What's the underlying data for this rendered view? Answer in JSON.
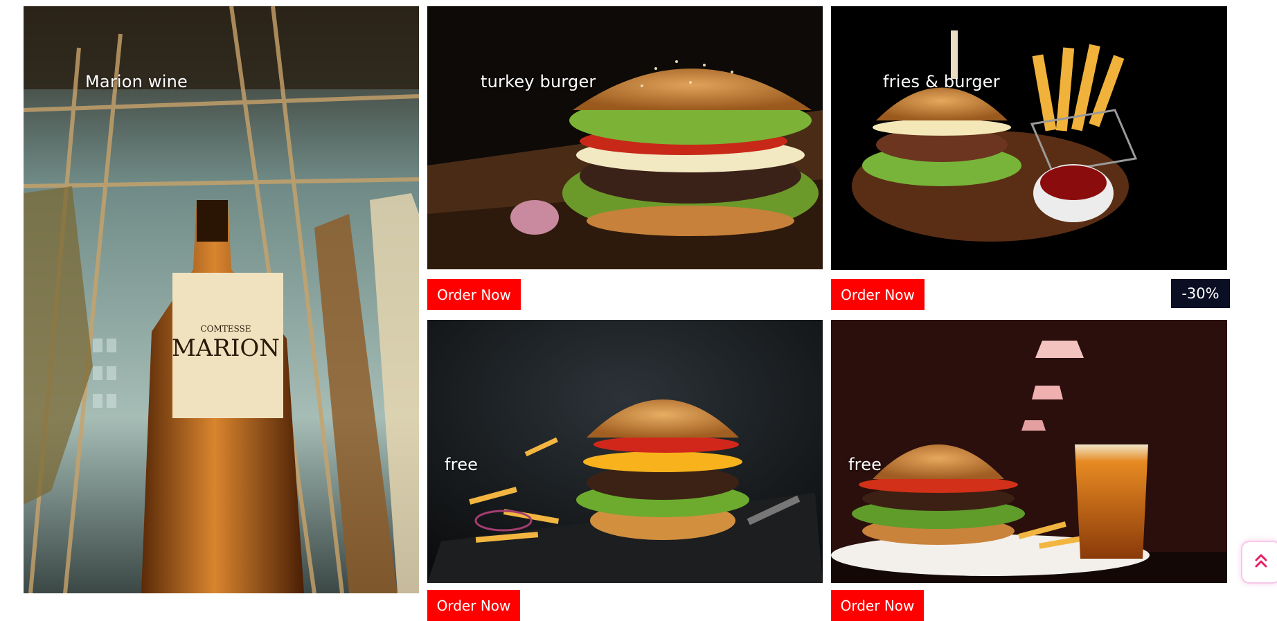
{
  "tiles": {
    "wine": {
      "caption": "Marion wine"
    },
    "turkey_burger": {
      "caption": "turkey burger",
      "order_label": "Order Now"
    },
    "fries_burger": {
      "caption": "fries & burger",
      "order_label": "Order Now",
      "discount": "-30%"
    },
    "free_1": {
      "caption": "free",
      "order_label": "Order Now"
    },
    "free_2": {
      "caption": "free",
      "order_label": "Order Now"
    }
  },
  "scroll_top": {
    "icon": "double-chevron-up-icon"
  },
  "colors": {
    "accent": "#ff0000",
    "badge": "#0b0f24",
    "scroll_border": "#f7c8e8"
  }
}
